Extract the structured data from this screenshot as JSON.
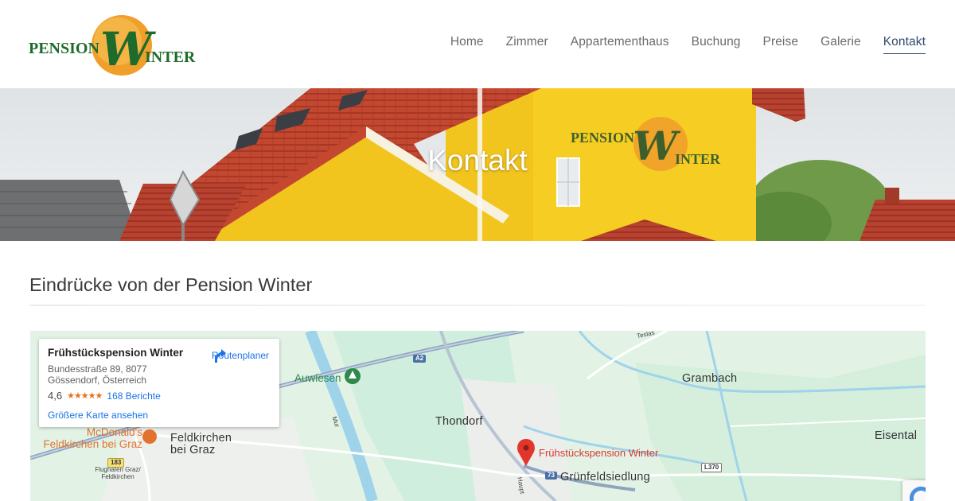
{
  "logo": {
    "word1": "PENSION",
    "initial": "W",
    "word2": "INTER"
  },
  "nav": {
    "items": [
      {
        "label": "Home",
        "active": false
      },
      {
        "label": "Zimmer",
        "active": false
      },
      {
        "label": "Appartementhaus",
        "active": false
      },
      {
        "label": "Buchung",
        "active": false
      },
      {
        "label": "Preise",
        "active": false
      },
      {
        "label": "Galerie",
        "active": false
      },
      {
        "label": "Kontakt",
        "active": true
      }
    ]
  },
  "hero": {
    "title": "Kontakt",
    "sign": {
      "word1": "PENSION",
      "initial": "W",
      "word2": "INTER"
    }
  },
  "section": {
    "title": "Eindrücke von der Pension Winter"
  },
  "map": {
    "card": {
      "title": "Frühstückspension Winter",
      "address": "Bundesstraße 89, 8077 Gössendorf, Österreich",
      "rating": "4,6",
      "stars": "★★★★★",
      "reviews": "168 Berichte",
      "route_label": "Routenplaner",
      "larger_map": "Größere Karte ansehen"
    },
    "labels": {
      "auwiesen": "Auwiesen",
      "grambach": "Grambach",
      "thondorf": "Thondorf",
      "eisental": "Eisental",
      "feldkirchen": "Feldkirchen bei Graz",
      "mcdonalds": "McDonald's Feldkirchen bei Graz",
      "pin_label": "Frühstückspension Winter",
      "gruenfeld": "Grünfeldsiedlung",
      "mur": "Mur",
      "teslastr": "Teslas",
      "haupt": "Haupt",
      "flughafen": "Flughafen Graz/ Feldkirchen"
    },
    "badges": {
      "a2": "A2",
      "r73": "73",
      "r183": "183",
      "l370": "L370"
    },
    "colors": {
      "water": "#9fd3ea",
      "park": "#c8ebd2",
      "road": "#ffffff",
      "highway": "#8fa4bf",
      "pin": "#e2362c"
    }
  },
  "colors": {
    "accent": "#2d4a6b",
    "house_yellow": "#f2c51e",
    "roof_red": "#c4482f",
    "logo_green": "#1f6b2c",
    "logo_orange": "#f0a02a"
  }
}
